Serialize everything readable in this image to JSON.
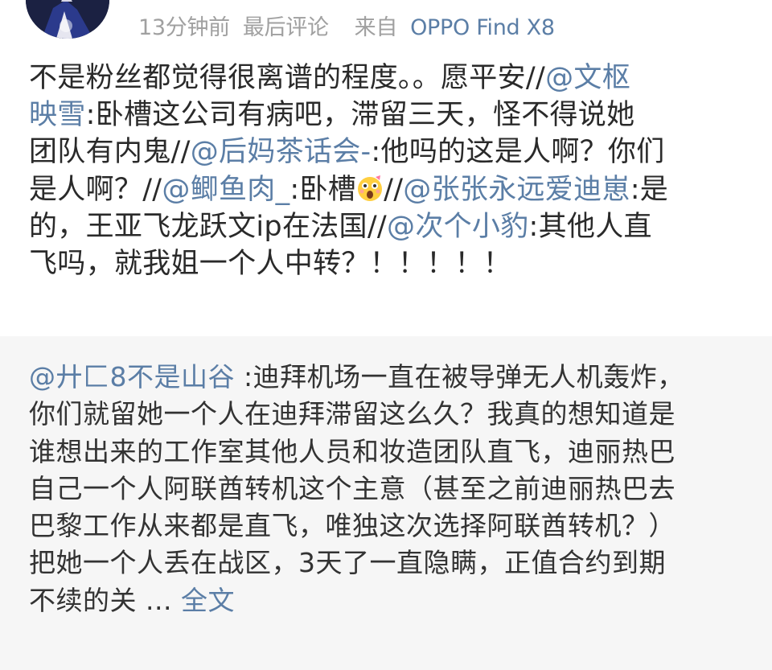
{
  "header": {
    "time": "13分钟前",
    "status": "最后评论",
    "source_prefix": "来自",
    "device": "OPPO Find X8"
  },
  "post": {
    "l1a": "不是粉丝都觉得很离谱的程度。。愿平安//",
    "m1": "@文枢",
    "m1b": "映雪",
    "l2a": ":卧槽这公司有病吧，滞留三天，怪不得说她",
    "l3a": "团队有内鬼//",
    "m2": "@后妈茶话会-",
    "l3b": ":他吗的这是人啊？你们",
    "l4a": "是人啊？//",
    "m3": "@鲫鱼肉_",
    "l4b": ":卧槽",
    "l4c": "//",
    "m4": "@张张永远爱迪崽",
    "l4d": ":是",
    "l5a": "的，王亚飞龙跃文ip在法国//",
    "m5": "@次个小豹",
    "l5b": ":其他人直",
    "l6a": "飞吗，就我姐一个人中转？！！！！！",
    "emoji_icon": "shocked-face-emoji"
  },
  "repost": {
    "author": "@廾匚8不是山谷",
    "r1": " :迪拜机场一直在被导弹无人机轰炸，",
    "r2": "你们就留她一个人在迪拜滞留这么久？我真的想知道是",
    "r3": "谁想出来的工作室其他人员和妆造团队直飞，迪丽热巴",
    "r4": "自己一个人阿联酋转机这个主意（甚至之前迪丽热巴去",
    "r5": "巴黎工作从来都是直飞，唯独这次选择阿联酋转机？）",
    "r6": "把她一个人丢在战区，3天了一直隐瞒，正值合约到期",
    "r7": "不续的关 ... ",
    "full_text": "全文"
  },
  "colors": {
    "link": "#5b7ea6",
    "text": "#2a2a2a",
    "meta": "#a0a0a0",
    "repost_bg": "#f6f6f6"
  }
}
